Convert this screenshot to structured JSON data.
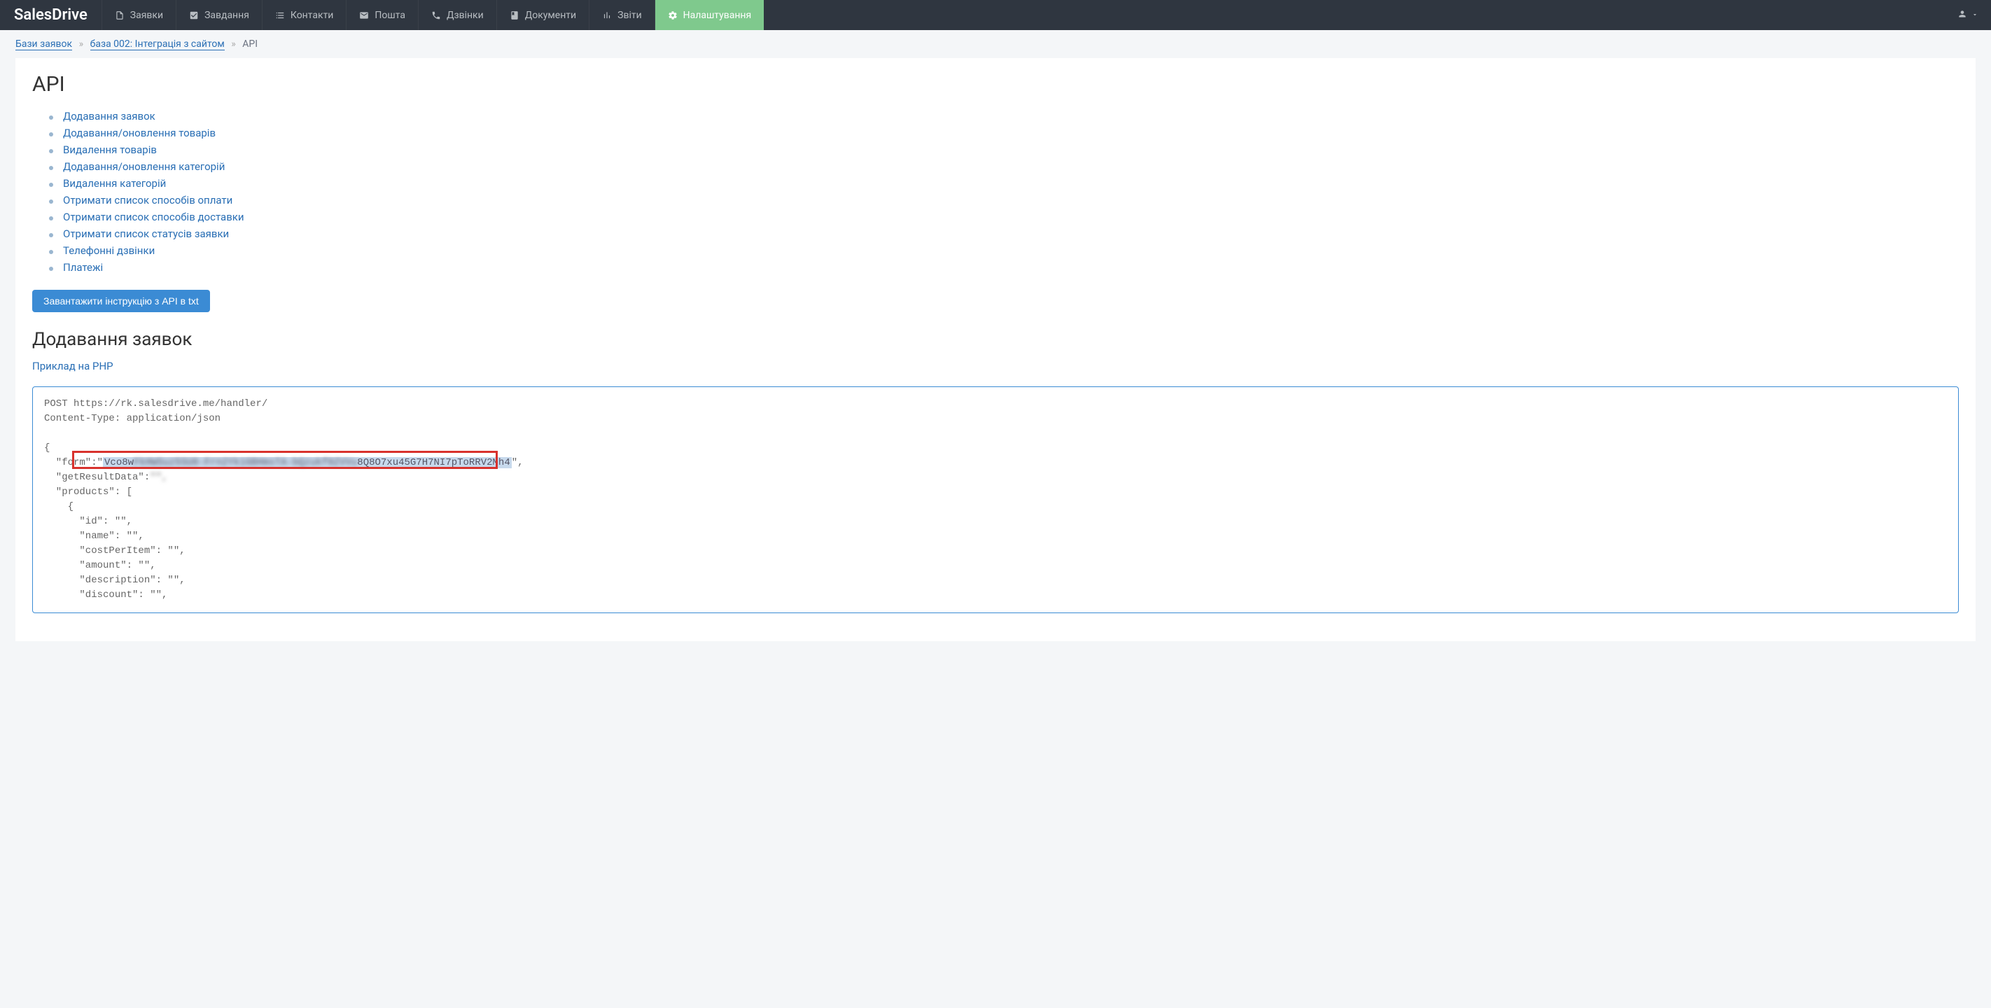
{
  "logo": "SalesDrive",
  "nav": {
    "items": [
      {
        "label": "Заявки"
      },
      {
        "label": "Завдання"
      },
      {
        "label": "Контакти"
      },
      {
        "label": "Пошта"
      },
      {
        "label": "Дзвінки"
      },
      {
        "label": "Документи"
      },
      {
        "label": "Звіти"
      },
      {
        "label": "Налаштування"
      }
    ]
  },
  "breadcrumbs": {
    "root": "Бази заявок",
    "parent": "база 002: Інтеграція з сайтом",
    "current": "API"
  },
  "page": {
    "title": "API",
    "toc": [
      "Додавання заявок",
      "Додавання/оновлення товарів",
      "Видалення товарів",
      "Додавання/оновлення категорій",
      "Видалення категорій",
      "Отримати список способів оплати",
      "Отримати список способів доставки",
      "Отримати список статусів заявки",
      "Телефонні дзвінки",
      "Платежі"
    ],
    "download_btn": "Завантажити інструкцію з API в txt",
    "section_title": "Додавання заявок",
    "example_link": "Приклад на PHP",
    "code": {
      "line1": "POST https://rk.salesdrive.me/handler/",
      "line2": "Content-Type: application/json",
      "brace_open": "{",
      "form_key": "  \"form\":\"",
      "form_token_prefix": "Vco8w",
      "form_token_middle": "FkHWSuz5SU0-Frn2Yk1GBHmsTA-bQzukf0ZVVu",
      "form_token_suffix": "8Q8O7xu45G7H7NI7pToRRV2Mh4",
      "form_end": "\",",
      "getresult_key": "  \"getResultData\":",
      "products_open": "  \"products\": [",
      "obj_open": "    {",
      "id_line": "      \"id\": \"\",",
      "name_line": "      \"name\": \"\",",
      "cost_line": "      \"costPerItem\": \"\",",
      "amount_line": "      \"amount\": \"\",",
      "desc_line": "      \"description\": \"\",",
      "discount_line": "      \"discount\": \"\","
    }
  }
}
